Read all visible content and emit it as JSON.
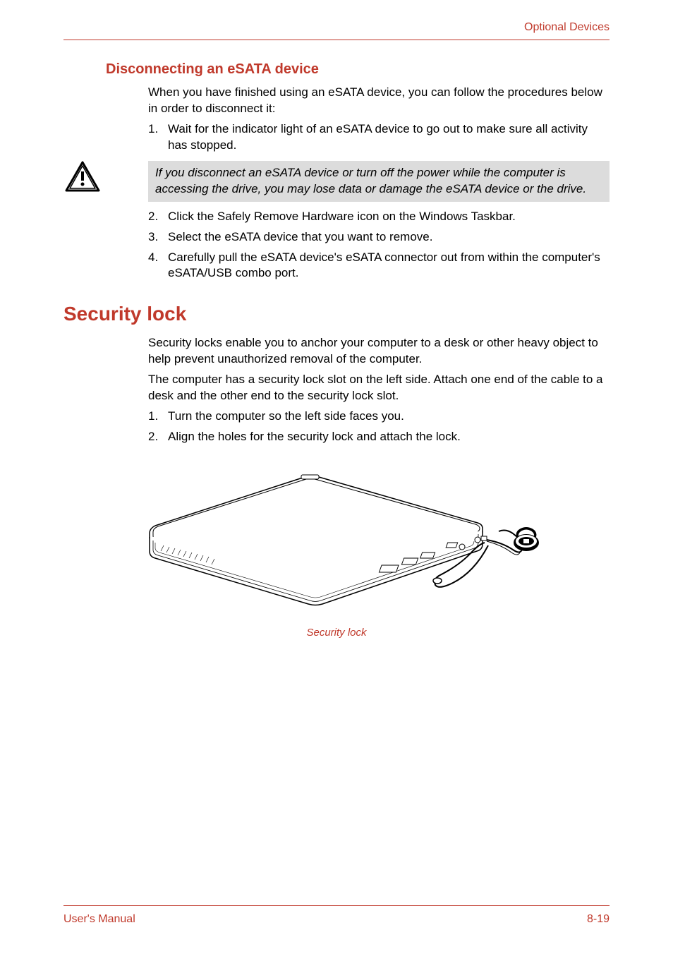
{
  "header": {
    "title": "Optional Devices"
  },
  "section1": {
    "heading": "Disconnecting an eSATA device",
    "intro": "When you have finished using an eSATA device, you can follow the procedures below in order to disconnect it:",
    "step1_num": "1.",
    "step1_text": "Wait for the indicator light of an eSATA device to go out to make sure all activity has stopped.",
    "warning": "If you disconnect an eSATA device or turn off the power while the computer is accessing the drive, you may lose data or damage the eSATA device or the drive.",
    "step2_num": "2.",
    "step2_text": "Click the Safely Remove Hardware icon on the Windows Taskbar.",
    "step3_num": "3.",
    "step3_text": "Select the eSATA device that you want to remove.",
    "step4_num": "4.",
    "step4_text": "Carefully pull the eSATA device's eSATA connector out from within the computer's eSATA/USB combo port."
  },
  "section2": {
    "heading": "Security lock",
    "para1": "Security locks enable you to anchor your computer to a desk or other heavy object to help prevent unauthorized removal of the computer.",
    "para2": "The computer has a security lock slot on the left side. Attach one end of the cable to a desk and the other end to the security lock slot.",
    "step1_num": "1.",
    "step1_text": "Turn the computer so the left side faces you.",
    "step2_num": "2.",
    "step2_text": "Align the holes for the security lock and attach the lock.",
    "figure_caption": "Security lock"
  },
  "footer": {
    "left": "User's Manual",
    "right": "8-19"
  }
}
